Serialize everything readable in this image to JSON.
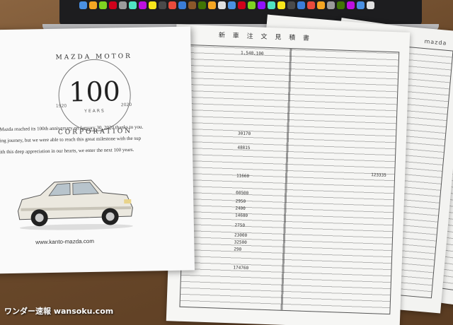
{
  "brochure": {
    "emblem_top": "MAZDA MOTOR",
    "emblem_number": "100",
    "emblem_years": "YEARS",
    "emblem_bottom": "CORPORATION",
    "year_start": "1920",
    "year_end": "2020",
    "line1": "Mazda reached its 100th anniversary on January 30, 2020 thanks to you.",
    "line2": "ing journey, but we were able to reach this great milestone with the sup",
    "line3": "ith this deep appreciation in our hearts, we enter the next 100 years.",
    "url": "www.kanto-mazda.com"
  },
  "documents": {
    "title": "新 車 注 文 見 積 書",
    "brand": "mazda",
    "rows": [
      "1,540,100",
      "30170",
      "48815",
      "11660",
      "60500",
      "2950",
      "2400",
      "14680",
      "2750",
      "23000",
      "32500",
      "290",
      "174760",
      "123335"
    ]
  },
  "watermark": "ワンダー速報  wansoku.com",
  "colors": {
    "table": "#c9b28f",
    "paper": "#f6f6f4",
    "car_body": "#e9e6dc"
  }
}
